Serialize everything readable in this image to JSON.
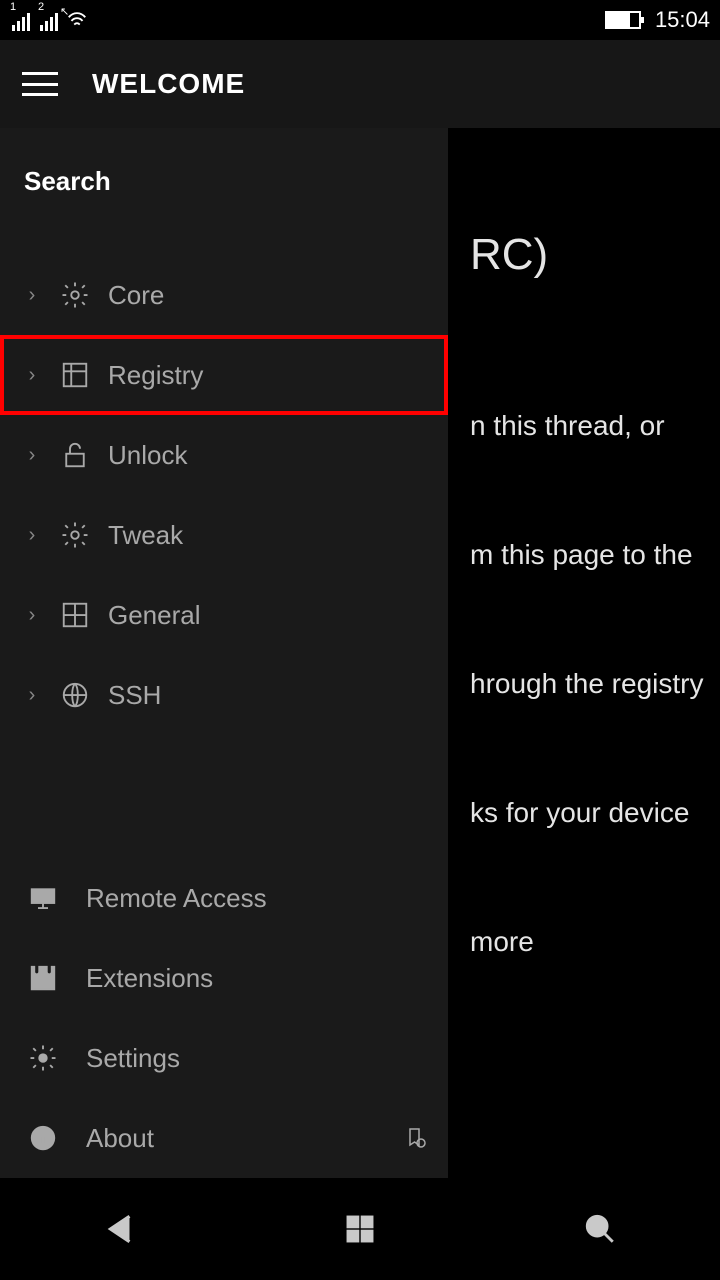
{
  "status": {
    "sim1": "1",
    "sim2": "2",
    "time": "15:04"
  },
  "header": {
    "title": "WELCOME"
  },
  "sidebar": {
    "search_label": "Search",
    "items": [
      {
        "label": "Core"
      },
      {
        "label": "Registry"
      },
      {
        "label": "Unlock"
      },
      {
        "label": "Tweak"
      },
      {
        "label": "General"
      },
      {
        "label": "SSH"
      }
    ],
    "bottom": [
      {
        "label": "Remote Access"
      },
      {
        "label": "Extensions"
      },
      {
        "label": "Settings"
      },
      {
        "label": "About"
      }
    ]
  },
  "background": {
    "title_fragment": "RC)",
    "lines": [
      "n this thread, or",
      "m this page to the",
      "hrough the registry",
      "ks for your device",
      "more"
    ]
  }
}
